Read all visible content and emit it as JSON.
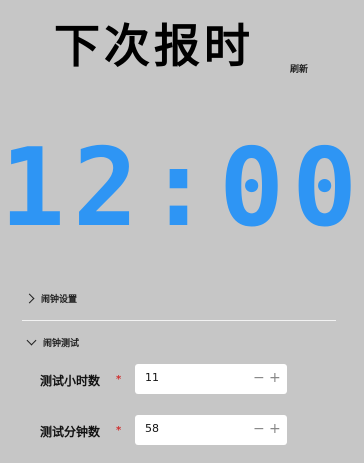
{
  "header": {
    "title": "下次报时",
    "refresh_label": "刷新"
  },
  "clock": {
    "time": "12:00",
    "color": "#2e95f4"
  },
  "sections": [
    {
      "label": "闹钟设置",
      "expanded": false,
      "icon": "chevron-right-icon"
    },
    {
      "label": "闹钟测试",
      "expanded": true,
      "icon": "chevron-down-icon"
    }
  ],
  "form": {
    "hour": {
      "label": "测试小时数",
      "required": "*",
      "value": "11",
      "minus": "−",
      "plus": "+"
    },
    "minute": {
      "label": "测试分钟数",
      "required": "*",
      "value": "58",
      "minus": "−",
      "plus": "+"
    }
  },
  "colors": {
    "background": "#c6c6c6",
    "accent": "#2e95f4",
    "required": "#d03030"
  }
}
